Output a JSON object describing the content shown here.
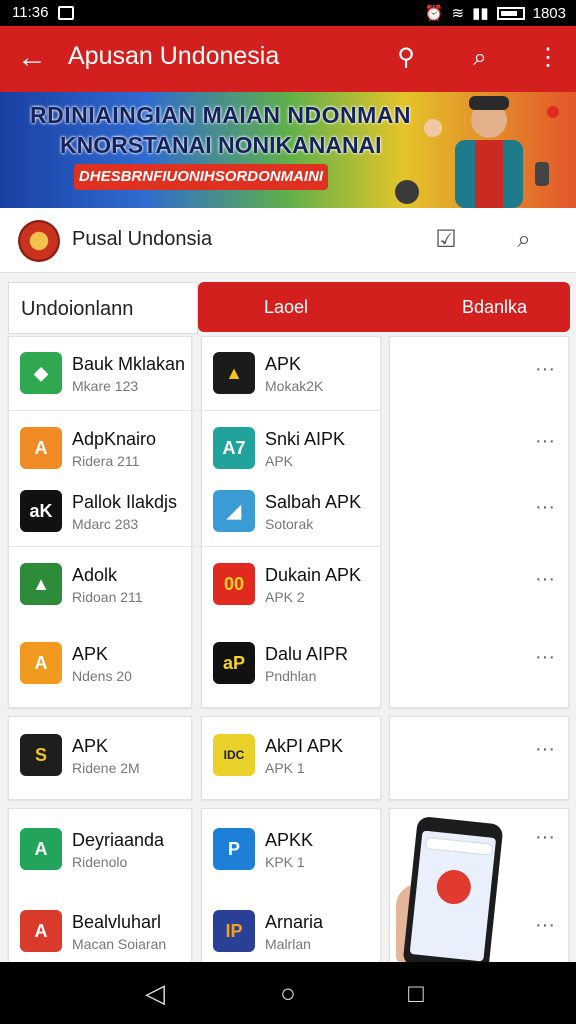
{
  "status": {
    "time": "11:36",
    "right_time": "1803"
  },
  "appbar": {
    "title": "Apusan Undonesia"
  },
  "banner": {
    "line1": "RDINIAINGIAN MAIAN NDONMAN",
    "line2": "KNORSTANAI NONIKANANAI",
    "cta": "DHESBRNFIUONIHSORDONMAINI"
  },
  "search": {
    "label": "Pusal Undonsia"
  },
  "tabs": {
    "first": "Undoionlann",
    "second": "Laoel",
    "third": "Bdanlka"
  },
  "apps": [
    {
      "name": "Bauk Mklakan",
      "sub": "Mkare 123",
      "glyph": "◆",
      "color": "#2fa84f"
    },
    {
      "name": "APK",
      "sub": "Mokak2K",
      "glyph": "▲",
      "color": "#1b1b1b"
    },
    {
      "name": "AdpKnairo",
      "sub": "Ridera 211",
      "glyph": "A",
      "color": "#f08a24"
    },
    {
      "name": "Snki AIPK",
      "sub": "APK",
      "glyph": "A7",
      "color": "#1fa39a"
    },
    {
      "name": "Pallok Ilakdjs",
      "sub": "Mdarc 283",
      "glyph": "aK",
      "color": "#111111"
    },
    {
      "name": "Salbah APK",
      "sub": "Sotorak",
      "glyph": "◢",
      "color": "#3a9bd5"
    },
    {
      "name": "Adolk",
      "sub": "Ridoan 211",
      "glyph": "▲",
      "color": "#2e8b3a"
    },
    {
      "name": "Dukain APK",
      "sub": "APK 2",
      "glyph": "00",
      "color": "#e12a1f"
    },
    {
      "name": "APK",
      "sub": "Ndens 20",
      "glyph": "A",
      "color": "#f29a1f"
    },
    {
      "name": "Dalu AIPR",
      "sub": "Pndhlan",
      "glyph": "aP",
      "color": "#111111"
    },
    {
      "name": "APK",
      "sub": "Ridene 2M",
      "glyph": "S",
      "color": "#1e1e1e"
    },
    {
      "name": "AkPI APK",
      "sub": "APK 1",
      "glyph": "IDC",
      "color": "#e9d12a"
    },
    {
      "name": "Deyriaanda",
      "sub": "Ridenolo",
      "glyph": "A",
      "color": "#22a55a"
    },
    {
      "name": "APKK",
      "sub": "KPK 1",
      "glyph": "P",
      "color": "#1e7fd6"
    },
    {
      "name": "Bealvluharl",
      "sub": "Macan Soiaran",
      "glyph": "A",
      "color": "#d93a2a"
    },
    {
      "name": "Arnaria",
      "sub": "Malrlan",
      "glyph": "IP",
      "color": "#2a3f96"
    }
  ],
  "more_glyph": "···",
  "nav": {
    "back": "◁",
    "home": "○",
    "recent": "□"
  }
}
